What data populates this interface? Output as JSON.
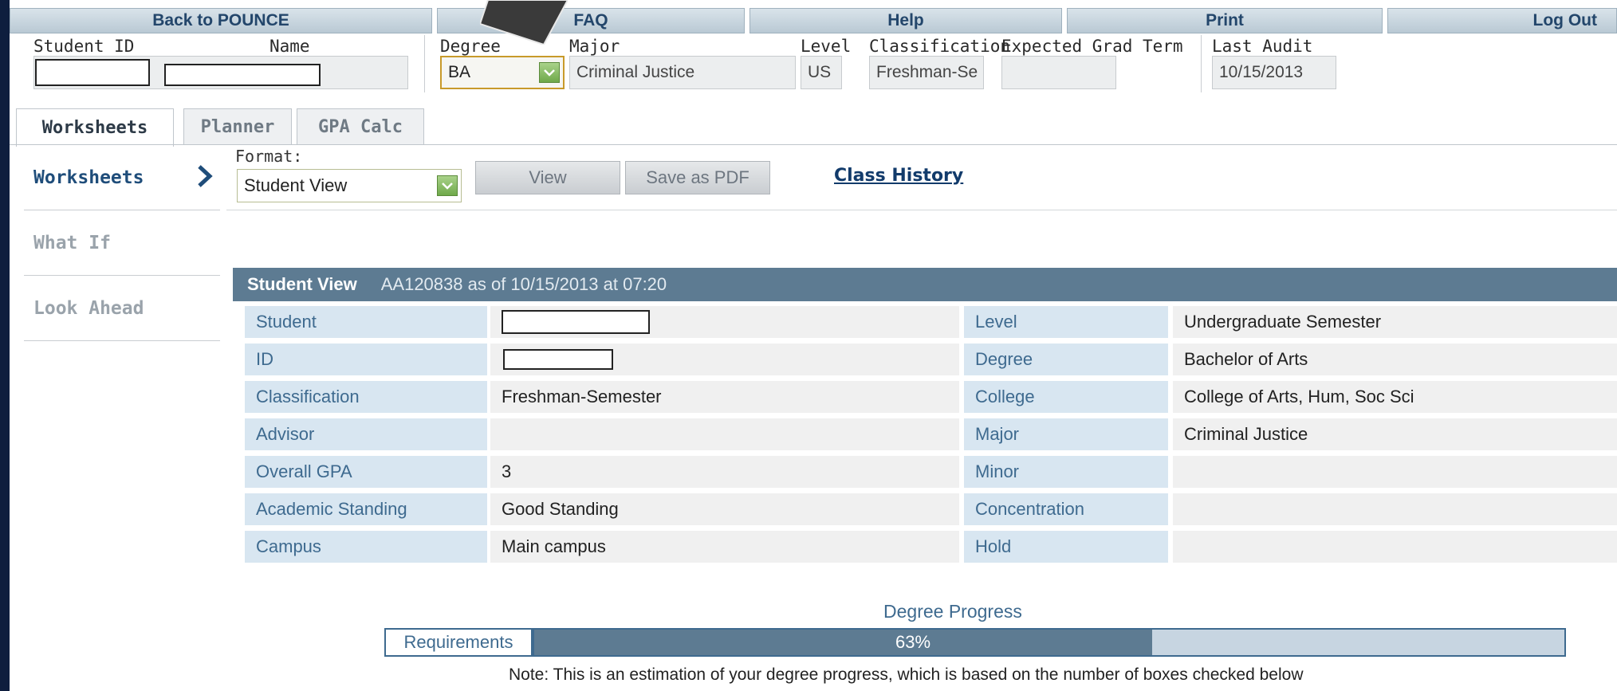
{
  "nav": {
    "back": "Back to POUNCE",
    "faq": "FAQ",
    "help": "Help",
    "print": "Print",
    "logout": "Log Out"
  },
  "header": {
    "student_id_label": "Student ID",
    "name_label": "Name",
    "degree_label": "Degree",
    "degree_value": "BA",
    "major_label": "Major",
    "major_value": "Criminal Justice",
    "level_label": "Level",
    "level_value": "US",
    "classification_label": "Classification",
    "classification_value": "Freshman-Se",
    "grad_term_label": "Expected Grad Term",
    "grad_term_value": "",
    "last_audit_label": "Last Audit",
    "last_audit_value": "10/15/2013"
  },
  "tabs": [
    "Worksheets",
    "Planner",
    "GPA Calc"
  ],
  "left_nav": [
    "Worksheets",
    "What If",
    "Look Ahead"
  ],
  "format": {
    "label": "Format:",
    "value": "Student View",
    "view_button": "View",
    "pdf_button": "Save as PDF",
    "class_history": "Class History"
  },
  "panel": {
    "title": "Student View",
    "subtitle": "AA120838 as of 10/15/2013 at 07:20",
    "left_rows": [
      {
        "label": "Student",
        "value": ""
      },
      {
        "label": "ID",
        "value": ""
      },
      {
        "label": "Classification",
        "value": "Freshman-Semester"
      },
      {
        "label": "Advisor",
        "value": ""
      },
      {
        "label": "Overall GPA",
        "value": "3"
      },
      {
        "label": "Academic Standing",
        "value": "Good Standing"
      },
      {
        "label": "Campus",
        "value": "Main campus"
      }
    ],
    "right_rows": [
      {
        "label": "Level",
        "value": "Undergraduate Semester"
      },
      {
        "label": "Degree",
        "value": "Bachelor of Arts"
      },
      {
        "label": "College",
        "value": "College of Arts, Hum, Soc Sci"
      },
      {
        "label": "Major",
        "value": "Criminal Justice"
      },
      {
        "label": "Minor",
        "value": ""
      },
      {
        "label": "Concentration",
        "value": ""
      },
      {
        "label": "Hold",
        "value": ""
      }
    ]
  },
  "progress": {
    "title": "Degree Progress",
    "label": "Requirements",
    "percent_text": "63%",
    "fraction": 0.6,
    "note": "Note: This is an estimation of your degree progress, which is based on the number of boxes checked below"
  },
  "colors": {
    "accent": "#5d7b92",
    "label_bg": "#d8e6f1",
    "label_text": "#3e6a8f",
    "border_frame": "#0e1e3e"
  }
}
